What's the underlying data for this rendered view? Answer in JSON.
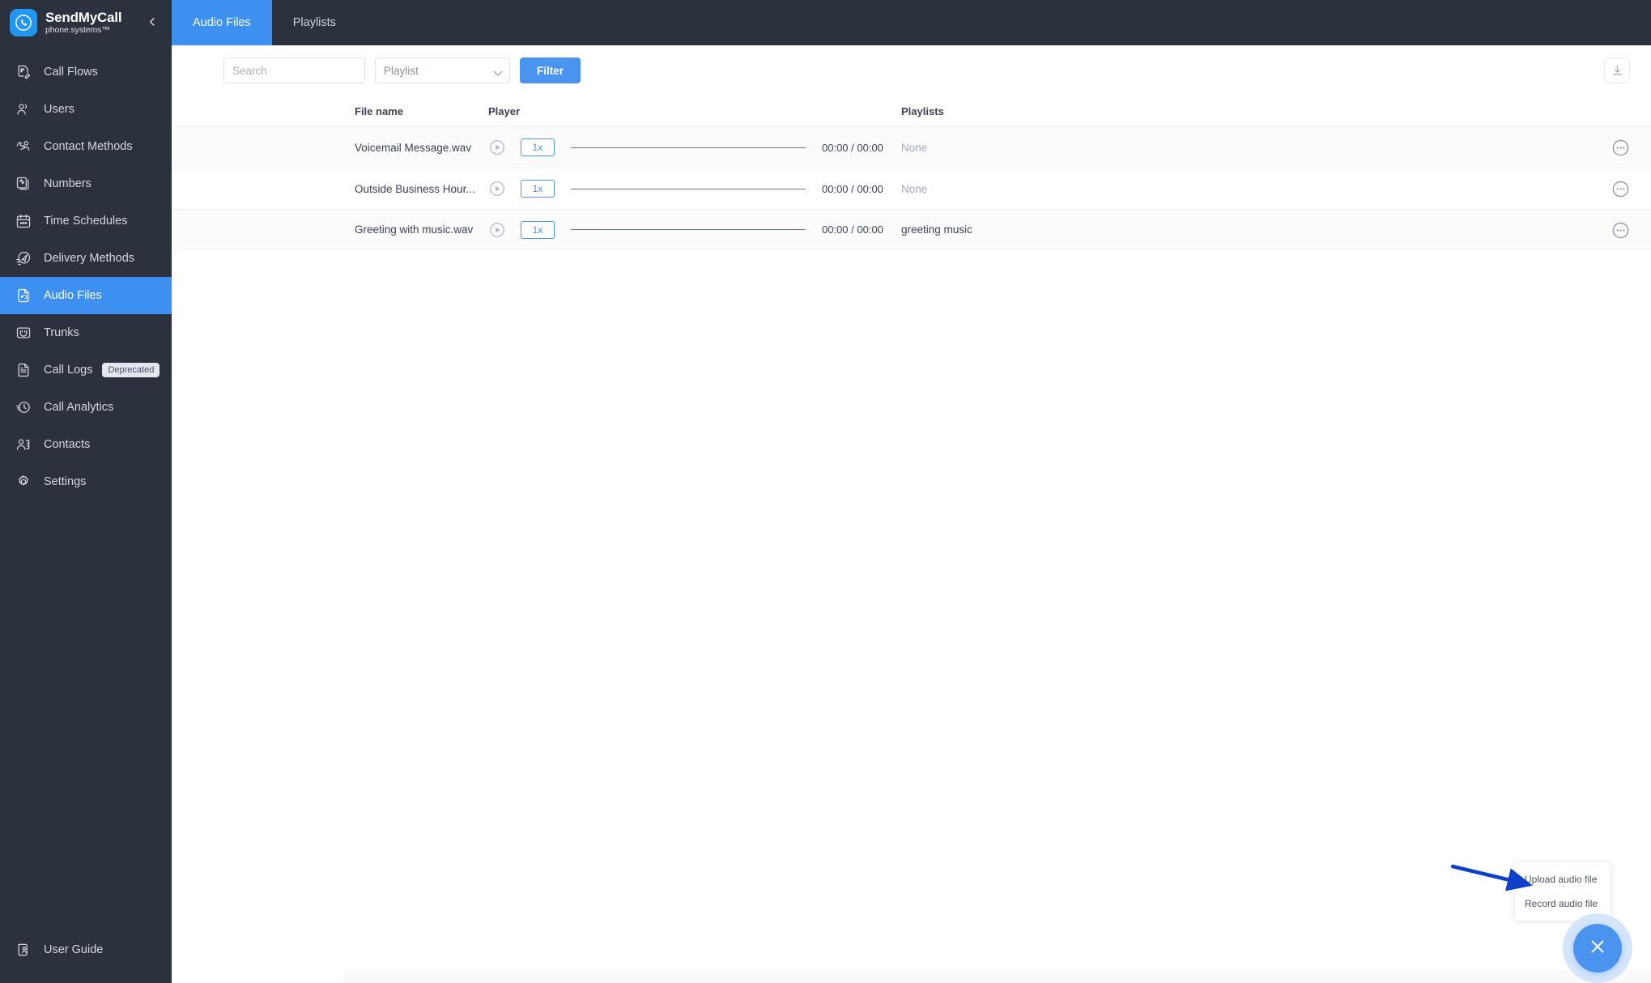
{
  "brand": {
    "name": "SendMyCall",
    "subtitle": "phone.systems™",
    "logo_icon": "phone-circle-icon",
    "collapse_icon": "chevron-left-icon",
    "accent_color": "#3d90f0",
    "sidebar_color": "#2b313d"
  },
  "sidebar": {
    "items": [
      {
        "label": "Call Flows",
        "icon": "call-flow-icon",
        "active": false
      },
      {
        "label": "Users",
        "icon": "users-icon",
        "active": false
      },
      {
        "label": "Contact Methods",
        "icon": "contact-methods-icon",
        "active": false
      },
      {
        "label": "Numbers",
        "icon": "numbers-icon",
        "active": false
      },
      {
        "label": "Time Schedules",
        "icon": "calendar-icon",
        "active": false
      },
      {
        "label": "Delivery Methods",
        "icon": "delivery-icon",
        "active": false
      },
      {
        "label": "Audio Files",
        "icon": "audio-file-icon",
        "active": true
      },
      {
        "label": "Trunks",
        "icon": "trunk-icon",
        "active": false
      },
      {
        "label": "Call Logs",
        "icon": "document-icon",
        "active": false,
        "badge": "Deprecated"
      },
      {
        "label": "Call Analytics",
        "icon": "analytics-clock-icon",
        "active": false
      },
      {
        "label": "Contacts",
        "icon": "contacts-icon",
        "active": false
      },
      {
        "label": "Settings",
        "icon": "gear-icon",
        "active": false
      }
    ],
    "bottom": {
      "label": "User Guide",
      "icon": "user-guide-icon"
    }
  },
  "tabs": [
    {
      "label": "Audio Files",
      "active": true
    },
    {
      "label": "Playlists",
      "active": false
    }
  ],
  "toolbar": {
    "search_value": "",
    "search_placeholder": "Search",
    "playlist_select_value": "Playlist",
    "playlist_chevron_icon": "chevron-down-icon",
    "filter_label": "Filter",
    "download_icon": "download-icon"
  },
  "table": {
    "columns": [
      "File name",
      "Player",
      "Playlists"
    ],
    "rows": [
      {
        "file_name": "Voicemail Message.wav",
        "play_icon": "play-circle-icon",
        "speed": "1x",
        "time": "00:00 / 00:00",
        "playlist": "None",
        "playlist_empty": true,
        "menu_icon": "more-options-icon"
      },
      {
        "file_name": "Outside Business Hour...",
        "play_icon": "play-circle-icon",
        "speed": "1x",
        "time": "00:00 / 00:00",
        "playlist": "None",
        "playlist_empty": true,
        "menu_icon": "more-options-icon"
      },
      {
        "file_name": "Greeting with music.wav",
        "play_icon": "play-circle-icon",
        "speed": "1x",
        "time": "00:00 / 00:00",
        "playlist": "greeting music",
        "playlist_empty": false,
        "menu_icon": "more-options-icon"
      }
    ]
  },
  "fab": {
    "icon": "close-x-icon",
    "color": "#4a93ef",
    "menu_items": [
      {
        "label": "Upload audio file"
      },
      {
        "label": "Record audio file"
      }
    ]
  },
  "annotation": {
    "arrow_color": "#0d3fc8",
    "points_to": "Upload audio file"
  }
}
